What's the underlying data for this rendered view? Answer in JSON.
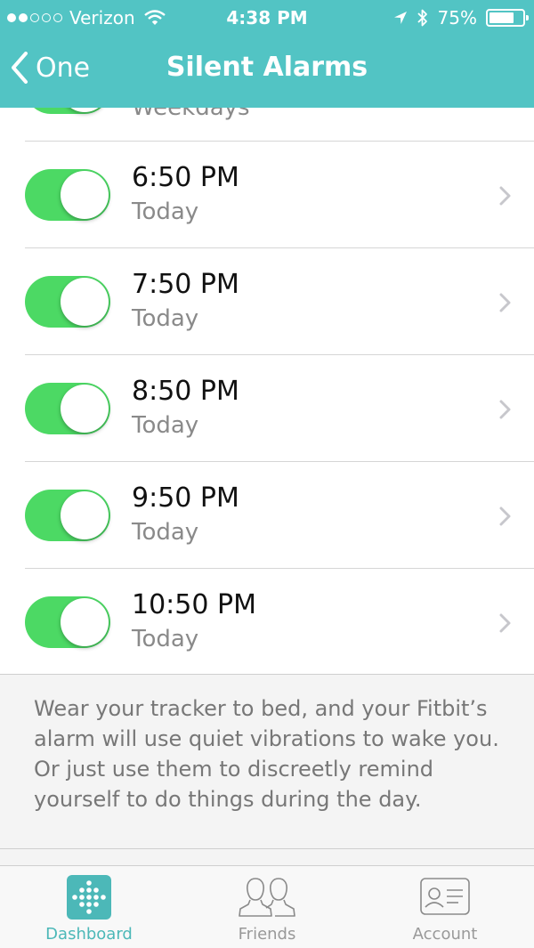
{
  "status_bar": {
    "carrier": "Verizon",
    "time": "4:38 PM",
    "battery_label": "75%",
    "battery_level": 0.75,
    "signal_bars_filled": 2,
    "signal_bars_total": 5
  },
  "nav": {
    "back_label": "One",
    "title": "Silent Alarms"
  },
  "partial_row": {
    "repeat": "Weekdays"
  },
  "alarms": [
    {
      "time": "6:50 PM",
      "repeat": "Today",
      "enabled": true
    },
    {
      "time": "7:50 PM",
      "repeat": "Today",
      "enabled": true
    },
    {
      "time": "8:50 PM",
      "repeat": "Today",
      "enabled": true
    },
    {
      "time": "9:50 PM",
      "repeat": "Today",
      "enabled": true
    },
    {
      "time": "10:50 PM",
      "repeat": "Today",
      "enabled": true
    }
  ],
  "footer_note": "Wear your tracker to bed, and your Fitbit’s alarm will use quiet vibrations to wake you. Or just use them to discreetly remind yourself to do things during the day.",
  "tabs": [
    {
      "label": "Dashboard",
      "icon": "dashboard-icon",
      "active": true
    },
    {
      "label": "Friends",
      "icon": "friends-icon",
      "active": false
    },
    {
      "label": "Account",
      "icon": "account-icon",
      "active": false
    }
  ],
  "colors": {
    "header": "#52c4c4",
    "toggle_on": "#4cd964",
    "tab_active": "#4cb8b8"
  }
}
